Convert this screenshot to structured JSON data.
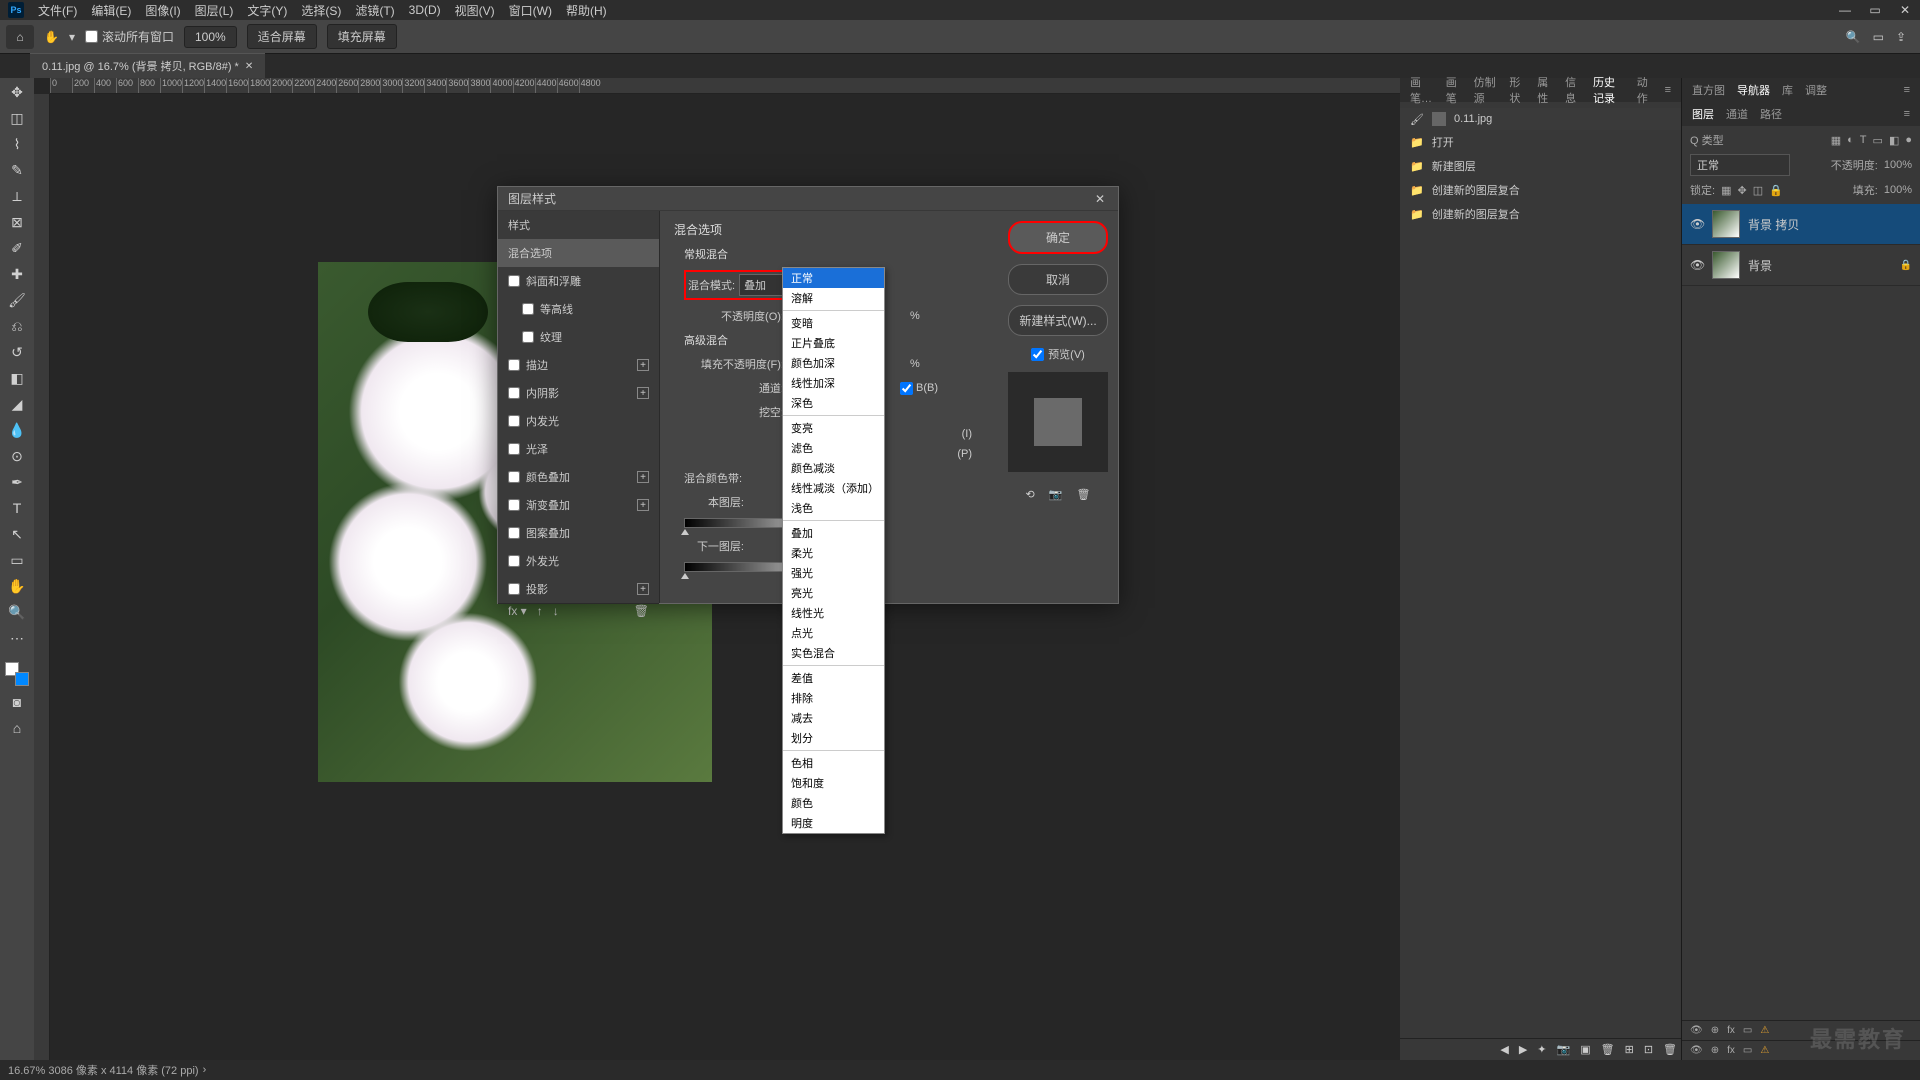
{
  "menubar": {
    "items": [
      "文件(F)",
      "编辑(E)",
      "图像(I)",
      "图层(L)",
      "文字(Y)",
      "选择(S)",
      "滤镜(T)",
      "3D(D)",
      "视图(V)",
      "窗口(W)",
      "帮助(H)"
    ]
  },
  "options": {
    "scroll_all": "滚动所有窗口",
    "zoom": "100%",
    "fit_screen": "适合屏幕",
    "fill_screen": "填充屏幕"
  },
  "doc_tab": {
    "title": "0.11.jpg @ 16.7% (背景 拷贝, RGB/8#) *"
  },
  "ruler_marks": [
    "0",
    "200",
    "400",
    "600",
    "800",
    "1000",
    "1200",
    "1400",
    "1600",
    "1800",
    "2000",
    "2200",
    "2400",
    "2600",
    "2800",
    "3000",
    "3200",
    "3400",
    "3600",
    "3800",
    "4000",
    "4200",
    "4400",
    "4600",
    "4800"
  ],
  "panel_tabs1": [
    "画笔…",
    "画笔",
    "仿制源",
    "形状",
    "属性",
    "信息",
    "历史记录",
    "动作"
  ],
  "panel_tabs1_active": "历史记录",
  "panel_tabs2": [
    "直方图",
    "导航器",
    "库",
    "调整"
  ],
  "panel_tabs2_active": "导航器",
  "panel_tabs3": [
    "图层",
    "通道",
    "路径"
  ],
  "panel_tabs3_active": "图层",
  "history": {
    "doc": "0.11.jpg",
    "items": [
      "打开",
      "新建图层",
      "创建新的图层复合",
      "创建新的图层复合"
    ]
  },
  "layers": {
    "kind_label": "Q 类型",
    "mode": "正常",
    "opacity_label": "不透明度:",
    "opacity_val": "100%",
    "lock_label": "锁定:",
    "fill_label": "填充:",
    "fill_val": "100%",
    "items": [
      {
        "name": "背景 拷贝",
        "locked": false,
        "active": true
      },
      {
        "name": "背景",
        "locked": true,
        "active": false
      }
    ]
  },
  "dialog": {
    "title": "图层样式",
    "left_title": "样式",
    "blend_options": "混合选项",
    "effects": [
      "斜面和浮雕",
      "等高线",
      "纹理",
      "描边",
      "内阴影",
      "内发光",
      "光泽",
      "颜色叠加",
      "渐变叠加",
      "图案叠加",
      "外发光",
      "投影"
    ],
    "effects_plus": [
      "描边",
      "内阴影",
      "颜色叠加",
      "渐变叠加",
      "投影"
    ],
    "section_blend": "混合选项",
    "section_normal": "常规混合",
    "blend_mode_label": "混合模式:",
    "blend_mode_value": "叠加",
    "opacity_label": "不透明度(O):",
    "pct": "%",
    "section_adv": "高级混合",
    "fill_opacity_label": "填充不透明度(F):",
    "channels_label": "通道:",
    "knockout_label": "挖空:",
    "chan_b": "B(B)",
    "letters": {
      "i": "(I)",
      "p": "(P)"
    },
    "blend_band_label": "混合颜色带:",
    "this_layer": "本图层:",
    "next_layer": "下一图层:",
    "buttons": {
      "ok": "确定",
      "cancel": "取消",
      "newstyle": "新建样式(W)..."
    },
    "preview": "预览(V)"
  },
  "dropdown_groups": [
    [
      "正常",
      "溶解"
    ],
    [
      "变暗",
      "正片叠底",
      "颜色加深",
      "线性加深",
      "深色"
    ],
    [
      "变亮",
      "滤色",
      "颜色减淡",
      "线性减淡（添加）",
      "浅色"
    ],
    [
      "叠加",
      "柔光",
      "强光",
      "亮光",
      "线性光",
      "点光",
      "实色混合"
    ],
    [
      "差值",
      "排除",
      "减去",
      "划分"
    ],
    [
      "色相",
      "饱和度",
      "颜色",
      "明度"
    ]
  ],
  "dropdown_highlight": "正常",
  "status": "16.67% 3086 像素 x 4114 像素 (72 ppi)",
  "watermark": "最需教育"
}
